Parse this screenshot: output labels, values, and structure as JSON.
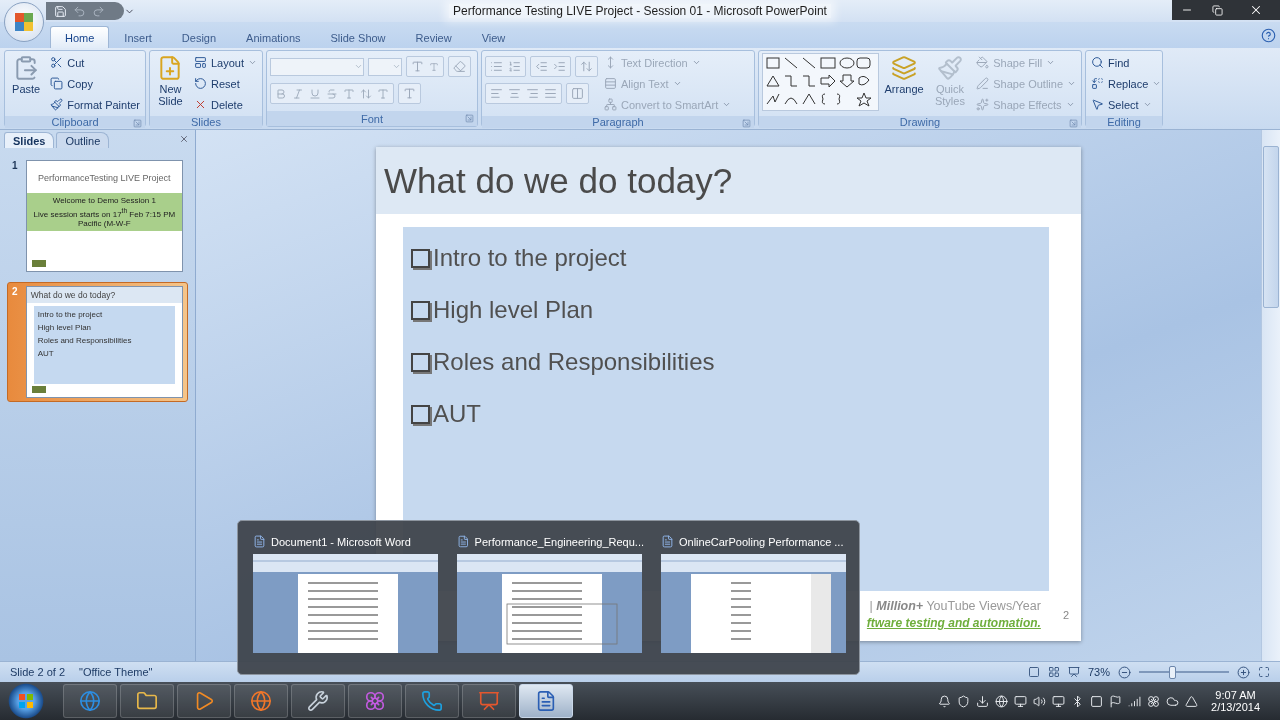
{
  "window": {
    "title": "Performance Testing LIVE Project - Session 01 - Microsoft PowerPoint"
  },
  "tabs": [
    {
      "label": "Home",
      "selected": true
    },
    {
      "label": "Insert",
      "selected": false
    },
    {
      "label": "Design",
      "selected": false
    },
    {
      "label": "Animations",
      "selected": false
    },
    {
      "label": "Slide Show",
      "selected": false
    },
    {
      "label": "Review",
      "selected": false
    },
    {
      "label": "View",
      "selected": false
    }
  ],
  "ribbon": {
    "groups": [
      {
        "kind": "clipboard",
        "label": "Clipboard",
        "buttons": [
          {
            "label": "Paste"
          }
        ],
        "items": [
          {
            "label": "Cut"
          },
          {
            "label": "Copy"
          },
          {
            "label": "Format Painter"
          }
        ]
      },
      {
        "kind": "slides",
        "label": "Slides",
        "buttons": [
          {
            "label": "New Slide"
          }
        ],
        "items": [
          {
            "label": "Layout"
          },
          {
            "label": "Reset"
          },
          {
            "label": "Delete"
          }
        ]
      },
      {
        "kind": "font",
        "label": "Font"
      },
      {
        "kind": "paragraph",
        "label": "Paragraph",
        "items": [
          {
            "label": "Text Direction",
            "disabled": true
          },
          {
            "label": "Align Text",
            "disabled": true
          },
          {
            "label": "Convert to SmartArt",
            "disabled": true
          }
        ]
      },
      {
        "kind": "drawing",
        "label": "Drawing",
        "buttons": [
          {
            "label": "Arrange",
            "disabled": false
          },
          {
            "label": "Quick Styles",
            "disabled": true
          }
        ],
        "items": [
          {
            "label": "Shape Fill",
            "disabled": true
          },
          {
            "label": "Shape Outline",
            "disabled": true
          },
          {
            "label": "Shape Effects",
            "disabled": true
          }
        ]
      },
      {
        "kind": "editing",
        "label": "Editing",
        "items": [
          {
            "label": "Find"
          },
          {
            "label": "Replace"
          },
          {
            "label": "Select"
          }
        ]
      }
    ]
  },
  "slides_pane": {
    "tabs": [
      {
        "label": "Slides",
        "selected": true
      },
      {
        "label": "Outline",
        "selected": false
      }
    ],
    "slides": [
      {
        "kind": "title",
        "number": "1",
        "selected": false,
        "title": "PerformanceTesting LIVE Project",
        "band": [
          "Welcome to Demo Session 1",
          "Live session starts on 17$^{th}$ Feb 7:15 PM Pacific (M-W-F"
        ]
      },
      {
        "kind": "content",
        "number": "2",
        "selected": true,
        "title": "What do we do today?",
        "bullets": [
          "Intro to the project",
          "High level Plan",
          "Roles and Responsibilities",
          "AUT"
        ]
      }
    ]
  },
  "slide": {
    "title": "What do we do today?",
    "bullets": [
      "Intro to the project",
      "High level Plan",
      "Roles and Responsibilities",
      "AUT"
    ],
    "footer": [
      "| **Million+** YouTube Views/Year",
      "ftware testing and automation."
    ],
    "number": "2"
  },
  "status_bar": {
    "slide": "Slide 2 of 2",
    "theme": "\"Office Theme\"",
    "zoom": "73%",
    "zoom_slider": {
      "level": 0.37
    }
  },
  "taskbar": {
    "apps": [
      {
        "selected": false
      },
      {
        "selected": false
      },
      {
        "selected": false
      },
      {
        "selected": false
      },
      {
        "selected": false
      },
      {
        "selected": false
      },
      {
        "selected": false
      },
      {
        "selected": false
      },
      {
        "selected": true
      }
    ],
    "time": "9:07 AM",
    "date": "2/13/2014"
  },
  "previews": [
    {
      "title": "Document1 - Microsoft Word"
    },
    {
      "title": "Performance_Engineering_Requ..."
    },
    {
      "title": "OnlineCarPooling Performance ..."
    }
  ]
}
